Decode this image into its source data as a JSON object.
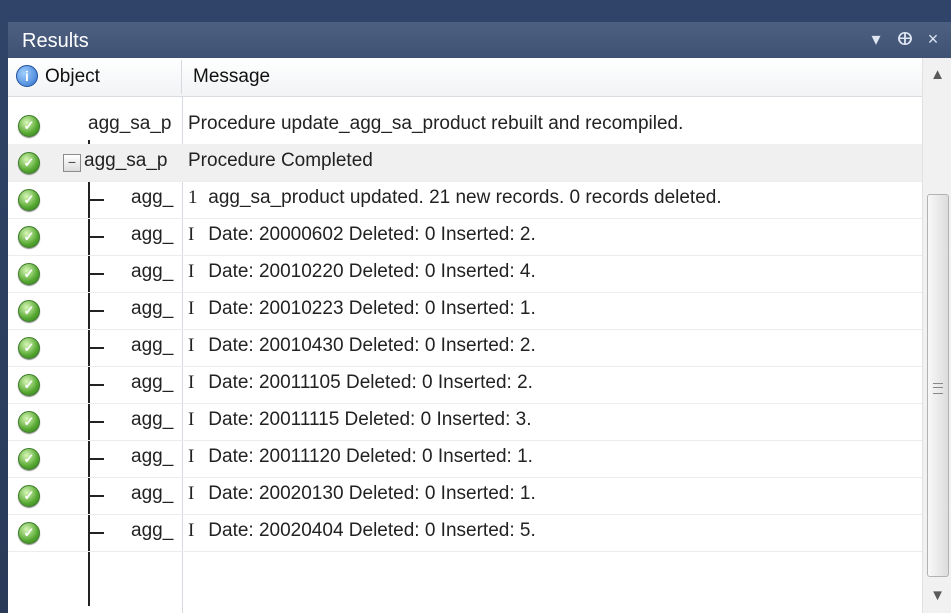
{
  "window": {
    "title": "Results",
    "dropdown_icon": "▾",
    "pin_icon": "ⴲ",
    "close_icon": "×"
  },
  "colors": {
    "frame": "#2f4468",
    "row_selected": "#f0f0f0",
    "status_green": "#56a831",
    "info_blue": "#2f6fcc"
  },
  "columns": {
    "status_icon": "info-icon",
    "object": "Object",
    "message": "Message"
  },
  "rows": [
    {
      "object": "agg_sa_p",
      "message": "Procedure update_agg_sa_product rebuilt  and recompiled.",
      "status": "success"
    },
    {
      "object": "agg_sa_p",
      "message": "Procedure Completed",
      "status": "success",
      "expander": "−",
      "selected": true
    },
    {
      "object": "agg_",
      "code": "1",
      "message": "agg_sa_product updated. 21 new records. 0 records deleted.",
      "status": "success"
    },
    {
      "object": "agg_",
      "code": "I",
      "message": "Date: 20000602 Deleted: 0 Inserted: 2.",
      "status": "success"
    },
    {
      "object": "agg_",
      "code": "I",
      "message": "Date: 20010220 Deleted: 0 Inserted: 4.",
      "status": "success"
    },
    {
      "object": "agg_",
      "code": "I",
      "message": "Date: 20010223 Deleted: 0 Inserted: 1.",
      "status": "success"
    },
    {
      "object": "agg_",
      "code": "I",
      "message": "Date: 20010430 Deleted: 0 Inserted: 2.",
      "status": "success"
    },
    {
      "object": "agg_",
      "code": "I",
      "message": "Date: 20011105 Deleted: 0 Inserted: 2.",
      "status": "success"
    },
    {
      "object": "agg_",
      "code": "I",
      "message": "Date: 20011115 Deleted: 0 Inserted: 3.",
      "status": "success"
    },
    {
      "object": "agg_",
      "code": "I",
      "message": "Date: 20011120 Deleted: 0 Inserted: 1.",
      "status": "success"
    },
    {
      "object": "agg_",
      "code": "I",
      "message": "Date: 20020130 Deleted: 0 Inserted: 1.",
      "status": "success"
    },
    {
      "object": "agg_",
      "code": "I",
      "message": "Date: 20020404 Deleted: 0 Inserted: 5.",
      "status": "success"
    }
  ],
  "scrollbar": {
    "up_icon": "▲",
    "down_icon": "▼"
  }
}
